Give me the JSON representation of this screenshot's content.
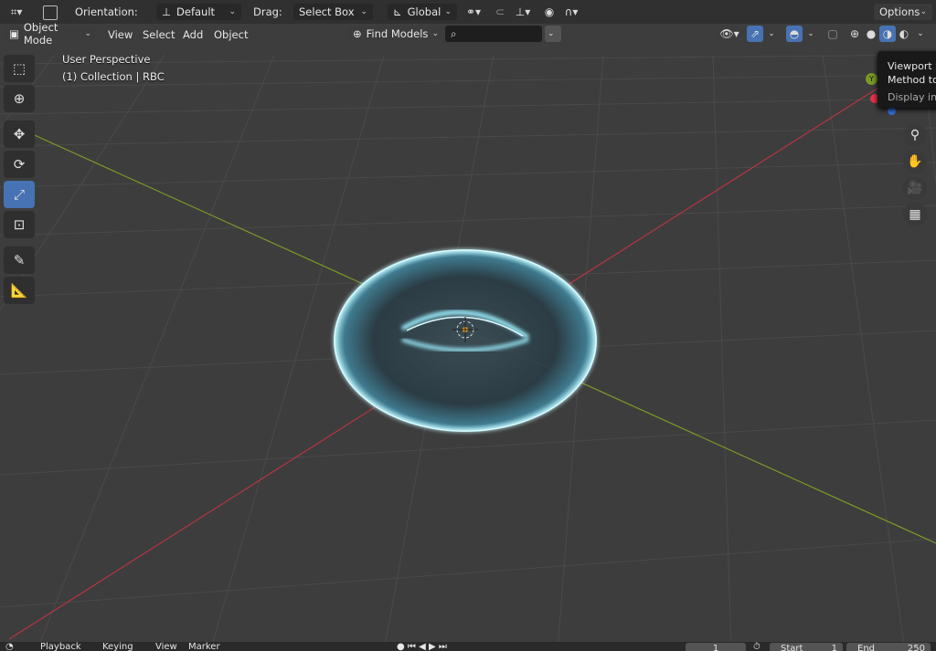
{
  "topbar": {
    "orientation_label": "Orientation:",
    "orientation_value": "Default",
    "drag_label": "Drag:",
    "drag_value": "Select Box",
    "transform_space": "Global",
    "options_label": "Options"
  },
  "header": {
    "mode": "Object Mode",
    "menu": [
      "View",
      "Select",
      "Add",
      "Object"
    ],
    "find_models": "Find Models"
  },
  "viewport": {
    "perspective": "User Perspective",
    "collection": "(1) Collection | RBC"
  },
  "tooltip": {
    "line1": "Viewport S",
    "line2": "Method to",
    "line3": "Display in"
  },
  "timeline": {
    "items": [
      "Playback",
      "Keying",
      "View",
      "Marker"
    ],
    "current_frame": "1",
    "start_label": "Start",
    "start_value": "1",
    "end_label": "End",
    "end_value": "250"
  },
  "colors": {
    "accent": "#4772b3",
    "x_axis": "#b53544",
    "y_axis": "#7a9a26",
    "object_glow": "#7fe6ff"
  },
  "icons": {
    "tools": [
      "select-box-icon",
      "cursor-icon",
      "move-icon",
      "rotate-icon",
      "scale-icon",
      "transform-icon",
      "annotate-icon",
      "measure-icon"
    ],
    "nav": [
      "zoom-icon",
      "pan-icon",
      "camera-icon",
      "grid-icon"
    ]
  }
}
